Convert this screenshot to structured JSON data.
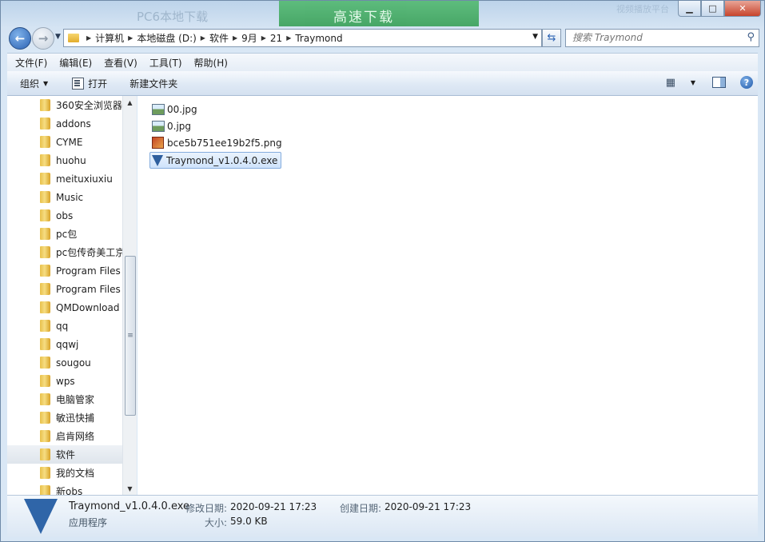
{
  "background": {
    "ad_left": "PC6本地下载",
    "ad_center": "高速下载",
    "ad_right": "视频播放平台"
  },
  "window_buttons": {
    "minimize": "▁",
    "maximize": "□",
    "close": "✕"
  },
  "address_bar": {
    "crumbs": [
      "计算机",
      "本地磁盘 (D:)",
      "软件",
      "9月",
      "21",
      "Traymond"
    ],
    "search_placeholder": "搜索 Traymond"
  },
  "menubar": [
    "文件(F)",
    "编辑(E)",
    "查看(V)",
    "工具(T)",
    "帮助(H)"
  ],
  "commandbar": {
    "organize": "组织",
    "open": "打开",
    "new_folder": "新建文件夹"
  },
  "nav_tree": [
    "360安全浏览器",
    "addons",
    "CYME",
    "huohu",
    "meituxiuxiu",
    "Music",
    "obs",
    "pc包",
    "pc包传奇美工京",
    "Program Files",
    "Program Files",
    "QMDownload",
    "qq",
    "qqwj",
    "sougou",
    "wps",
    "电脑管家",
    "敏迅快捕",
    "启肯网络",
    "软件",
    "我的文档",
    "新obs"
  ],
  "nav_selected_index": 19,
  "files": [
    {
      "name": "00.jpg",
      "icon": "image-icon",
      "selected": false
    },
    {
      "name": "0.jpg",
      "icon": "image-icon",
      "selected": false
    },
    {
      "name": "bce5b751ee19b2f5.png",
      "icon": "png-icon",
      "selected": false
    },
    {
      "name": "Traymond_v1.0.4.0.exe",
      "icon": "exe-icon",
      "selected": true
    }
  ],
  "details": {
    "file_name": "Traymond_v1.0.4.0.exe",
    "file_type": "应用程序",
    "modified_label": "修改日期:",
    "modified_value": "2020-09-21 17:23",
    "created_label": "创建日期:",
    "created_value": "2020-09-21 17:23",
    "size_label": "大小:",
    "size_value": "59.0 KB"
  }
}
